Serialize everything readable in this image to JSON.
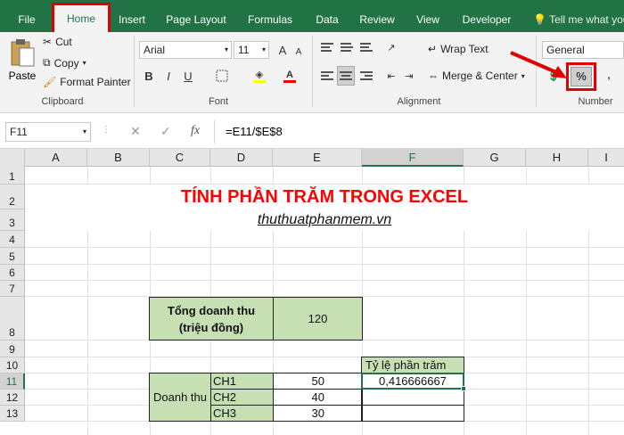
{
  "tabs": [
    "File",
    "Home",
    "Insert",
    "Page Layout",
    "Formulas",
    "Data",
    "Review",
    "View",
    "Developer"
  ],
  "tell_me": "Tell me what you",
  "clipboard": {
    "paste": "Paste",
    "cut": "Cut",
    "copy": "Copy",
    "format_painter": "Format Painter",
    "label": "Clipboard"
  },
  "font": {
    "name": "Arial",
    "size": "11",
    "label": "Font",
    "bold": "B",
    "italic": "I",
    "underline": "U",
    "grow": "A",
    "shrink": "A"
  },
  "alignment": {
    "wrap": "Wrap Text",
    "merge": "Merge & Center",
    "label": "Alignment"
  },
  "number": {
    "format": "General",
    "percent": "%",
    "comma": ",",
    "label": "Number"
  },
  "formula_bar": {
    "name_box": "F11",
    "cancel": "✕",
    "enter": "✓",
    "fx": "fx",
    "formula": "=E11/$E$8"
  },
  "columns": [
    "A",
    "B",
    "C",
    "D",
    "E",
    "F",
    "G",
    "H",
    "I"
  ],
  "rows": [
    "1",
    "2",
    "3",
    "4",
    "5",
    "6",
    "7",
    "8",
    "9",
    "10",
    "11",
    "12",
    "13"
  ],
  "sheet": {
    "title": "TÍNH PHẦN TRĂM TRONG EXCEL",
    "subtitle": "thuthuatphanmem.vn",
    "total_label": "Tổng doanh thu\n(triệu đồng)",
    "total_value": "120",
    "pct_header": "Tỷ lệ phần trăm",
    "group_label": "Doanh thu",
    "channels": [
      "CH1",
      "CH2",
      "CH3"
    ],
    "values": [
      "50",
      "40",
      "30"
    ],
    "result_f11": "0,416666667"
  },
  "colors": {
    "accent": "#217346",
    "highlight": "#e00000",
    "cell_green": "#c6e0b4",
    "title_red": "#ff0000"
  }
}
